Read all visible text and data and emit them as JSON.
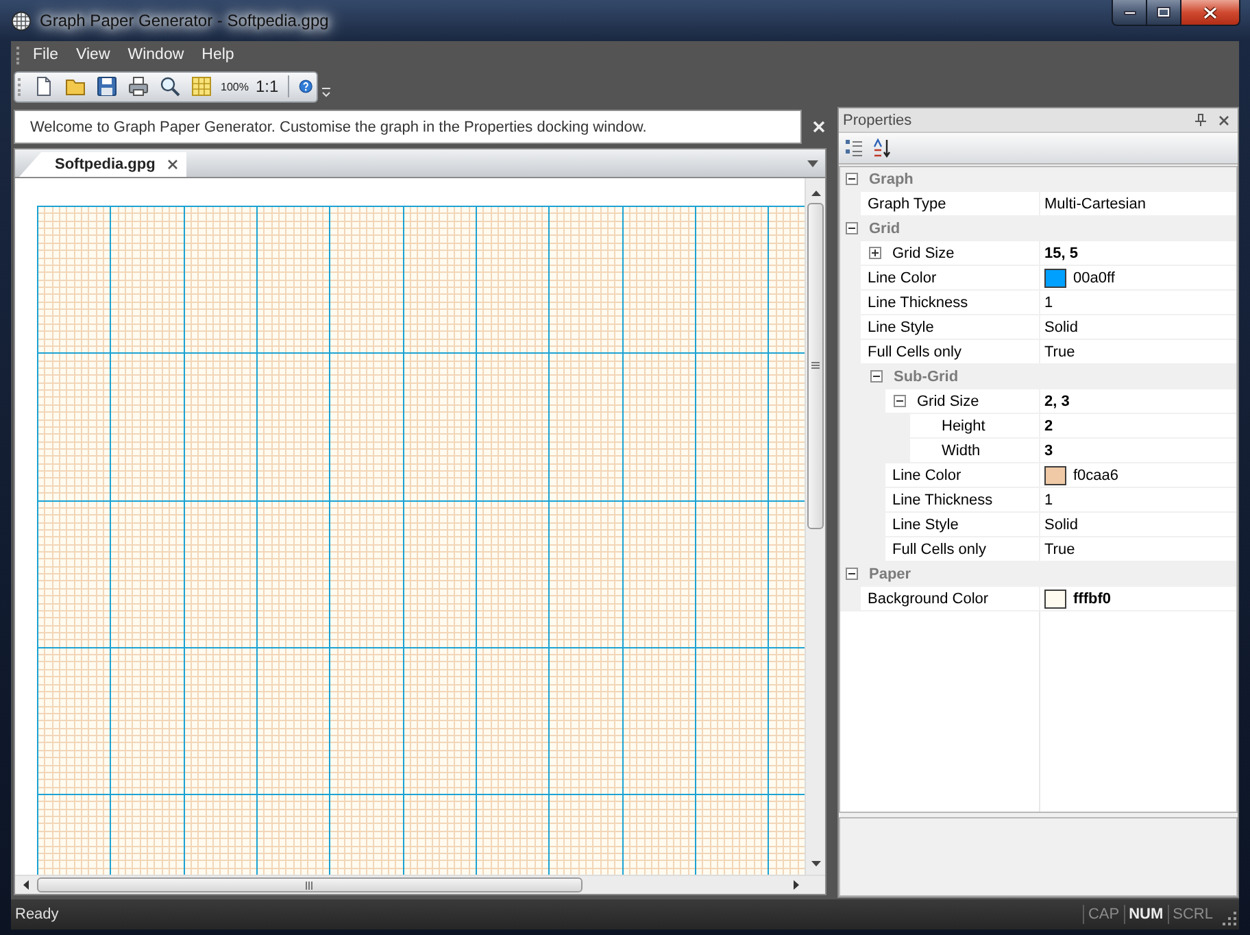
{
  "window": {
    "title": "Graph Paper Generator - Softpedia.gpg"
  },
  "menu": [
    {
      "label": "File"
    },
    {
      "label": "View"
    },
    {
      "label": "Window"
    },
    {
      "label": "Help"
    }
  ],
  "toolbar": {
    "buttons": [
      {
        "kind": "compact",
        "label": "100%"
      },
      {
        "kind": "plain",
        "label": "1:1"
      }
    ]
  },
  "info_bar": {
    "text": "Welcome to Graph Paper Generator. Customise the graph in the Properties docking window."
  },
  "document_tabs": [
    {
      "label": "Softpedia.gpg",
      "selected": true
    }
  ],
  "properties": {
    "title": "Properties",
    "rows": [
      {
        "kind": "category",
        "label": "Graph",
        "expanded": true,
        "children": [
          {
            "kind": "text",
            "label": "Graph Type",
            "value": "Multi-Cartesian",
            "modified": false
          }
        ]
      },
      {
        "kind": "category",
        "label": "Grid",
        "expanded": true,
        "children": [
          {
            "kind": "text",
            "label": "Grid Size",
            "value": "15, 5",
            "modified": true,
            "expanded": false
          },
          {
            "kind": "color",
            "label": "Line Color",
            "value": "00a0ff",
            "color": "#00a0ff",
            "modified": false
          },
          {
            "kind": "text",
            "label": "Line Thickness",
            "value": "1",
            "modified": false
          },
          {
            "kind": "text",
            "label": "Line Style",
            "value": "Solid",
            "modified": false
          },
          {
            "kind": "text",
            "label": "Full Cells only",
            "value": "True",
            "modified": false
          },
          {
            "kind": "category",
            "label": "Sub-Grid",
            "expanded": true,
            "children": [
              {
                "kind": "text",
                "label": "Grid Size",
                "value": "2, 3",
                "modified": true,
                "expanded": true,
                "children": [
                  {
                    "kind": "text",
                    "label": "Height",
                    "value": "2",
                    "modified": true
                  },
                  {
                    "kind": "text",
                    "label": "Width",
                    "value": "3",
                    "modified": true
                  }
                ]
              },
              {
                "kind": "color",
                "label": "Line Color",
                "value": "f0caa6",
                "color": "#f0caa6",
                "modified": false
              },
              {
                "kind": "text",
                "label": "Line Thickness",
                "value": "1",
                "modified": false
              },
              {
                "kind": "text",
                "label": "Line Style",
                "value": "Solid",
                "modified": false
              },
              {
                "kind": "text",
                "label": "Full Cells only",
                "value": "True",
                "modified": false
              }
            ]
          }
        ]
      },
      {
        "kind": "category",
        "label": "Paper",
        "expanded": true,
        "children": [
          {
            "kind": "color",
            "label": "Background Color",
            "value": "fffbf0",
            "color": "#fffbf0",
            "modified": true
          }
        ]
      }
    ]
  },
  "status_bar": {
    "text": "Ready",
    "indicators": [
      {
        "label": "CAP",
        "on": false
      },
      {
        "label": "NUM",
        "on": true
      },
      {
        "label": "SCRL",
        "on": false
      }
    ]
  }
}
